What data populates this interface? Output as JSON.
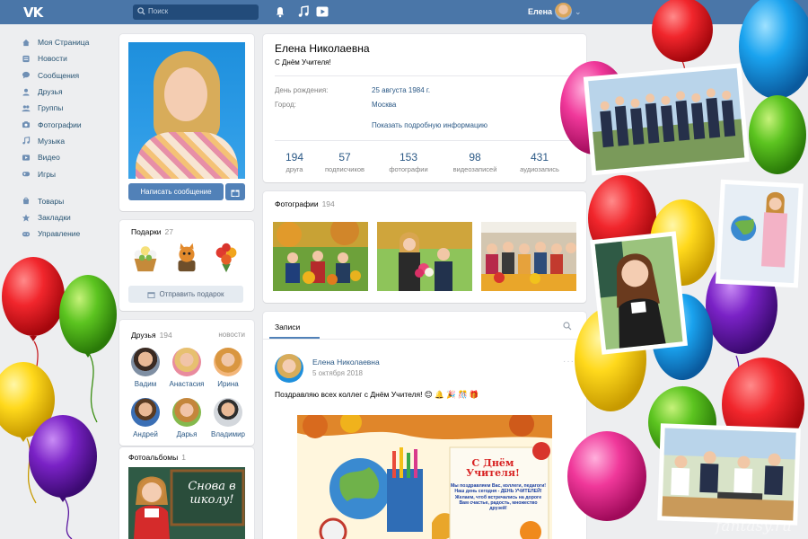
{
  "header": {
    "logo": "VK",
    "search_placeholder": "Поиск",
    "user_name": "Елена"
  },
  "menu": {
    "items": [
      {
        "label": "Моя Страница",
        "icon": "home-icon"
      },
      {
        "label": "Новости",
        "icon": "news-icon"
      },
      {
        "label": "Сообщения",
        "icon": "messages-icon"
      },
      {
        "label": "Друзья",
        "icon": "friends-icon"
      },
      {
        "label": "Группы",
        "icon": "groups-icon"
      },
      {
        "label": "Фотографии",
        "icon": "camera-icon"
      },
      {
        "label": "Музыка",
        "icon": "music-icon"
      },
      {
        "label": "Видео",
        "icon": "video-icon"
      },
      {
        "label": "Игры",
        "icon": "games-icon"
      }
    ],
    "items2": [
      {
        "label": "Товары",
        "icon": "goods-icon"
      },
      {
        "label": "Закладки",
        "icon": "star-icon"
      },
      {
        "label": "Управление",
        "icon": "gamepad-icon"
      }
    ]
  },
  "profile": {
    "name": "Елена Николаевна",
    "status": "С Днём Учителя!",
    "birthday_label": "День рождения:",
    "birthday_value": "25 августа 1984 г.",
    "city_label": "Город:",
    "city_value": "Москва",
    "more_info": "Показать подробную информацию",
    "counters": [
      {
        "value": "194",
        "label": "друга"
      },
      {
        "value": "57",
        "label": "подписчиков"
      },
      {
        "value": "153",
        "label": "фотографии"
      },
      {
        "value": "98",
        "label": "видеозаписей"
      },
      {
        "value": "431",
        "label": "аудиозапись"
      }
    ]
  },
  "avatar_card": {
    "message_button": "Написать сообщение"
  },
  "gifts": {
    "title": "Подарки",
    "count": "27",
    "send_button": "Отправить подарок"
  },
  "friends": {
    "title": "Друзья",
    "count": "194",
    "news_link": "новости",
    "list": [
      {
        "name": "Вадим"
      },
      {
        "name": "Анастасия"
      },
      {
        "name": "Ирина"
      },
      {
        "name": "Андрей"
      },
      {
        "name": "Дарья"
      },
      {
        "name": "Владимир"
      }
    ]
  },
  "albums": {
    "title": "Фотоальбомы",
    "count": "1",
    "cover_text": "Снова в школу!"
  },
  "photos": {
    "title": "Фотографии",
    "count": "194"
  },
  "wall": {
    "tab": "Записи",
    "post": {
      "author": "Елена Николаевна",
      "date": "5 октября 2018",
      "text": "Поздравляю всех коллег с Днём Учителя! 😊 🔔 🎉 🎊 🎁",
      "image_title": "С Днём Учителя!",
      "image_text": "Мы поздравляем Вас, коллеги, педагоги! Наш день сегодня - ДЕНЬ УЧИТЕЛЕЙ! Желаем, чтоб встречались на дороге Вам счастье, радость, множество друзей!"
    }
  },
  "watermark": "fantasy.ru",
  "colors": {
    "header": "#4a76a8",
    "accent": "#5181b8",
    "link": "#2a5885",
    "background": "#edeef0"
  }
}
